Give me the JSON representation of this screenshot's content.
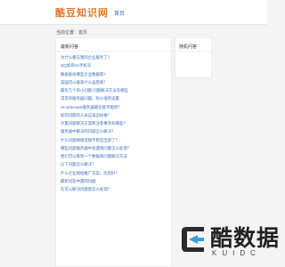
{
  "header": {
    "logo": "酷豆知识网",
    "nav_home": "首页"
  },
  "breadcrumb": "当前位置：首页",
  "main": {
    "title": "最新问答",
    "articles": [
      "为什么看在我的企业服务了？",
      "QQ如何VA手机号",
      "数据备份哪些企业数据库?",
      "美国可以联系什么运营商？",
      "最近几个的小问题 问题解决方法有哪些",
      "常见的服务器问题，防火墙的设置",
      "ok.safemask服务器最近能不能用？",
      "如何问题的人员应该怎样做？",
      "大量问题解决方案和注意事项有哪些?",
      "服务器中解决的问题怎么解决？",
      "什么问题网络连接不稳定出现了？",
      "哪些问题服务器中会遇到问题怎么处理？",
      "我们可以看到一个数据库问题解决方法",
      "以下问题怎么解决？",
      "什么企业网站推广方案，比较好？",
      "最新问答中遇到问题",
      "在可以解决问题后怎么处理？"
    ]
  },
  "sidebar": {
    "title": "随机问答"
  },
  "watermark": {
    "title": "酷数据",
    "subtitle": "KUIDC"
  }
}
